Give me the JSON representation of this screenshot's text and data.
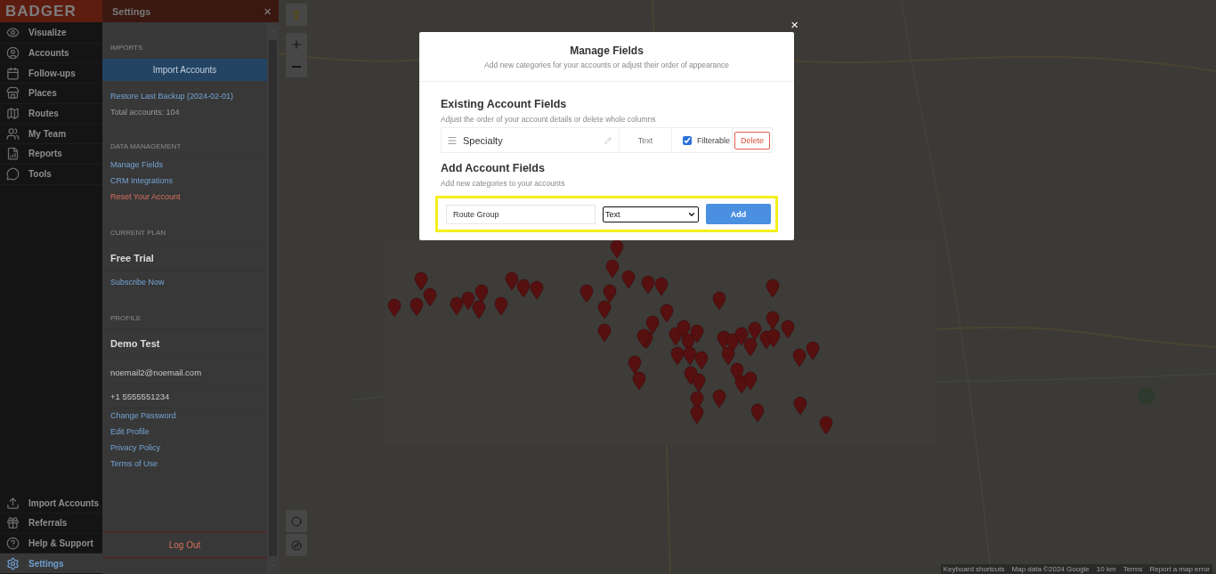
{
  "logo": "BADGER",
  "nav": {
    "items": [
      {
        "label": "Visualize",
        "selected": false
      },
      {
        "label": "Accounts",
        "selected": false
      },
      {
        "label": "Follow-ups",
        "selected": false
      },
      {
        "label": "Places",
        "selected": false
      },
      {
        "label": "Routes",
        "selected": false
      },
      {
        "label": "My Team",
        "selected": false
      },
      {
        "label": "Reports",
        "selected": false
      },
      {
        "label": "Tools",
        "selected": false
      }
    ],
    "bottom_items": [
      {
        "label": "Import Accounts",
        "selected": false
      },
      {
        "label": "Referrals",
        "selected": false
      },
      {
        "label": "Help & Support",
        "selected": false
      },
      {
        "label": "Settings",
        "selected": true
      }
    ]
  },
  "settings": {
    "title": "Settings",
    "close": "×",
    "sections": [
      {
        "label": "IMPORTS",
        "items": [
          {
            "kind": "button",
            "text": "Import Accounts"
          },
          {
            "kind": "link",
            "text": "Restore Last Backup (2024-02-01)"
          },
          {
            "kind": "note",
            "text": "Total accounts: 104"
          }
        ]
      },
      {
        "label": "DATA MANAGEMENT",
        "items": [
          {
            "kind": "link",
            "text": "Manage Fields"
          },
          {
            "kind": "link",
            "text": "CRM Integrations"
          },
          {
            "kind": "danger",
            "text": "Reset Your Account"
          }
        ]
      },
      {
        "label": "CURRENT PLAN",
        "items": [
          {
            "kind": "title",
            "text": "Free Trial"
          },
          {
            "kind": "link",
            "text": "Subscribe Now"
          }
        ]
      },
      {
        "label": "PROFILE",
        "items": [
          {
            "kind": "title",
            "text": "Demo Test"
          },
          {
            "kind": "info",
            "text": "noemail2@noemail.com"
          },
          {
            "kind": "info",
            "text": "+1 5555551234"
          },
          {
            "kind": "link",
            "text": "Change Password"
          },
          {
            "kind": "link",
            "text": "Edit Profile"
          },
          {
            "kind": "link",
            "text": "Privacy Policy"
          },
          {
            "kind": "link",
            "text": "Terms of Use"
          }
        ]
      }
    ],
    "logout": "Log Out"
  },
  "map": {
    "attribution": [
      "Keyboard shortcuts",
      "Map data ©2024 Google",
      "10 km",
      "Terms",
      "Report a map error"
    ]
  },
  "modal": {
    "close": "×",
    "title": "Manage Fields",
    "subtitle": "Add new categories for your accounts or adjust their order of appearance",
    "existing": {
      "heading": "Existing Account Fields",
      "subtitle": "Adjust the order of your account details or delete whole columns",
      "fields": [
        {
          "name": "Specialty",
          "type": "Text",
          "filterable_label": "Filterable",
          "filterable": true,
          "delete": "Delete"
        }
      ]
    },
    "add": {
      "heading": "Add Account Fields",
      "subtitle": "Add new categories to your accounts",
      "highlighted": true,
      "name_value": "Route Group",
      "type_value": "Text",
      "button": "Add"
    }
  }
}
